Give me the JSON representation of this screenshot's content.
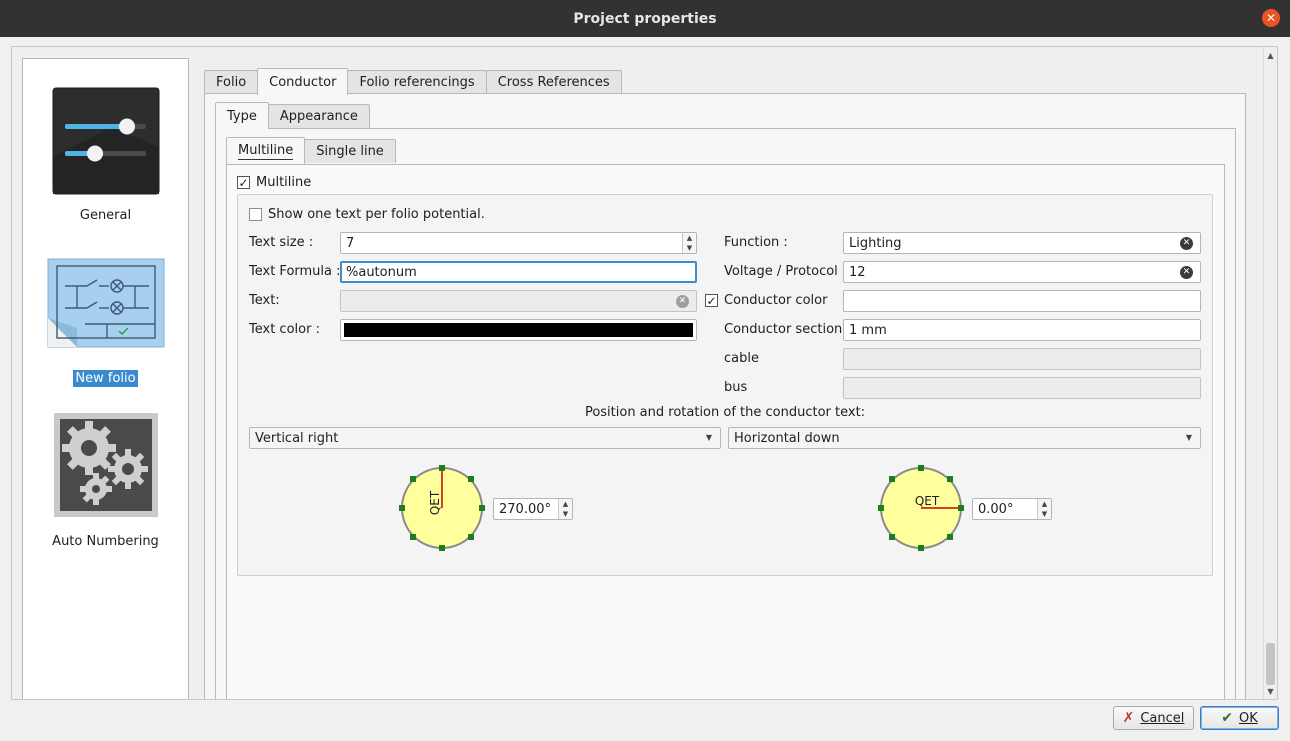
{
  "window": {
    "title": "Project properties"
  },
  "sidebar": {
    "items": [
      {
        "label": "General",
        "icon": "sliders-icon",
        "selected": false
      },
      {
        "label": "New folio",
        "icon": "folio-schematic-icon",
        "selected": true
      },
      {
        "label": "Auto Numbering",
        "icon": "gears-icon",
        "selected": false
      }
    ]
  },
  "tabs": {
    "main": [
      "Folio",
      "Conductor",
      "Folio referencings",
      "Cross References"
    ],
    "main_active": "Conductor",
    "sub": [
      "Type",
      "Appearance"
    ],
    "sub_active": "Type",
    "line": [
      "Multiline",
      "Single line"
    ],
    "line_active": "Multiline"
  },
  "multiline": {
    "checkbox_label": "Multiline",
    "checked": true,
    "one_text_label": "Show one text per folio potential.",
    "one_text_checked": false,
    "text_size_label": "Text size :",
    "text_size_value": "7",
    "text_formula_label": "Text Formula :",
    "text_formula_value": "%autonum",
    "text_label": "Text:",
    "text_value": "",
    "text_color_label": "Text color :",
    "text_color_value": "#000000",
    "function_label": "Function :",
    "function_value": "Lighting",
    "voltage_label": "Voltage / Protocol :",
    "voltage_value": "12",
    "conductor_color_label": "Conductor color",
    "conductor_color_checked": true,
    "conductor_color_value": "",
    "conductor_section_label": "Conductor section",
    "conductor_section_value": "1 mm",
    "cable_label": "cable",
    "cable_value": "",
    "bus_label": "bus",
    "bus_value": "",
    "position_title": "Position and rotation of the conductor text:",
    "vertical_combo": "Vertical right",
    "horizontal_combo": "Horizontal down",
    "vertical_dial_text": "QET",
    "vertical_angle": "270.00°",
    "horizontal_dial_text": "QET",
    "horizontal_angle": "0.00°"
  },
  "buttons": {
    "cancel": "Cancel",
    "ok": "OK"
  },
  "colors": {
    "titlebar": "#323232",
    "close": "#e95420",
    "selection": "#3a8ad0",
    "dial_fill": "#ffff9e",
    "dial_handle": "#1e7d1e",
    "dial_indicator": "#cc0000"
  }
}
